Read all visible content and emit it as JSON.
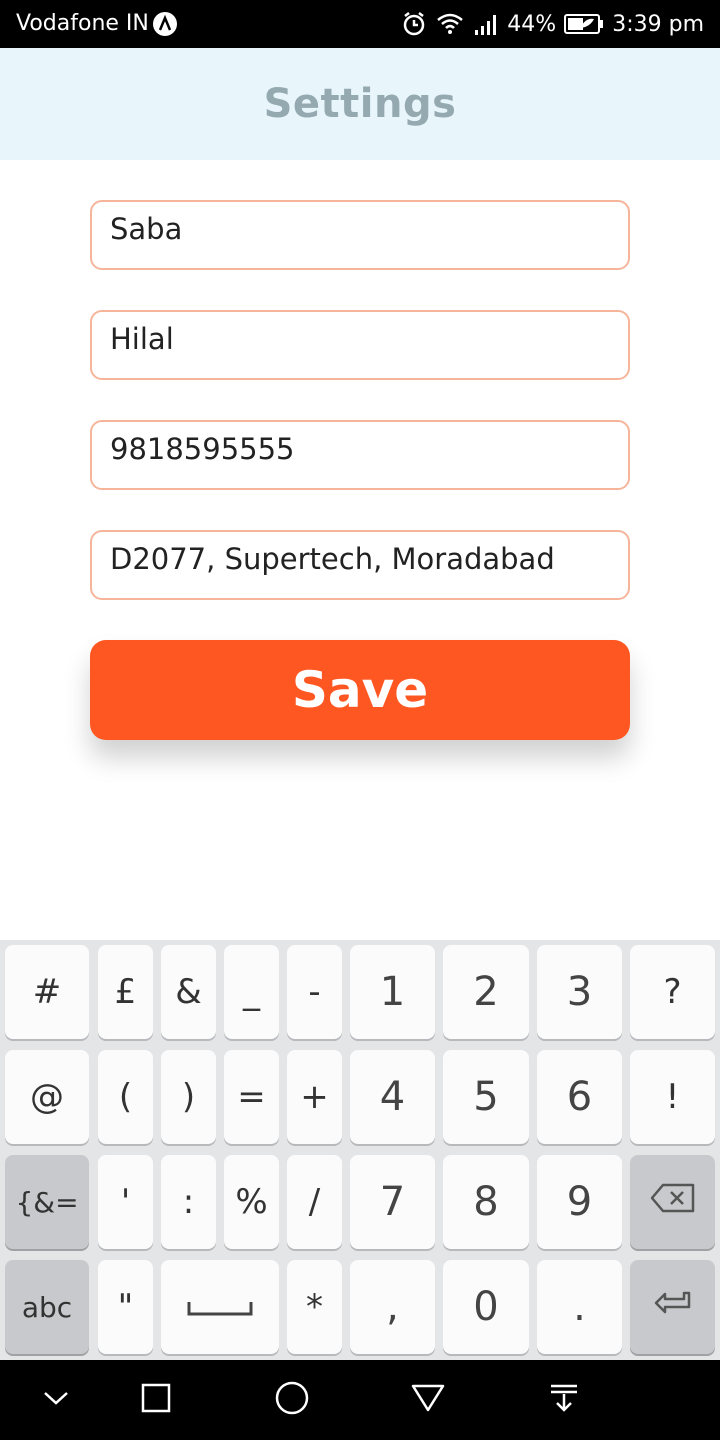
{
  "status_bar": {
    "carrier": "Vodafone IN",
    "battery": "44%",
    "time": "3:39 pm",
    "icons": [
      "alarm-icon",
      "wifi-icon",
      "signal-icon",
      "battery-icon"
    ]
  },
  "header": {
    "title": "Settings"
  },
  "form": {
    "first_name": "Saba",
    "last_name": "Hilal",
    "phone": "9818595555",
    "address": "D2077, Supertech, Moradabad",
    "save_label": "Save"
  },
  "keyboard": {
    "row1": [
      "#",
      "£",
      "&",
      "_",
      "-",
      "1",
      "2",
      "3",
      "?"
    ],
    "row2": [
      "@",
      "(",
      ")",
      "=",
      "+",
      "4",
      "5",
      "6",
      "!"
    ],
    "row3": [
      "{&=",
      "'",
      ":",
      "%",
      "/",
      "7",
      "8",
      "9"
    ],
    "row4": [
      "abc",
      "\"",
      "*",
      ",",
      "0",
      "."
    ]
  },
  "colors": {
    "accent": "#ff5722",
    "header_bg": "#e8f6fc",
    "header_title": "#95aab0",
    "field_border": "#f6b59b"
  }
}
